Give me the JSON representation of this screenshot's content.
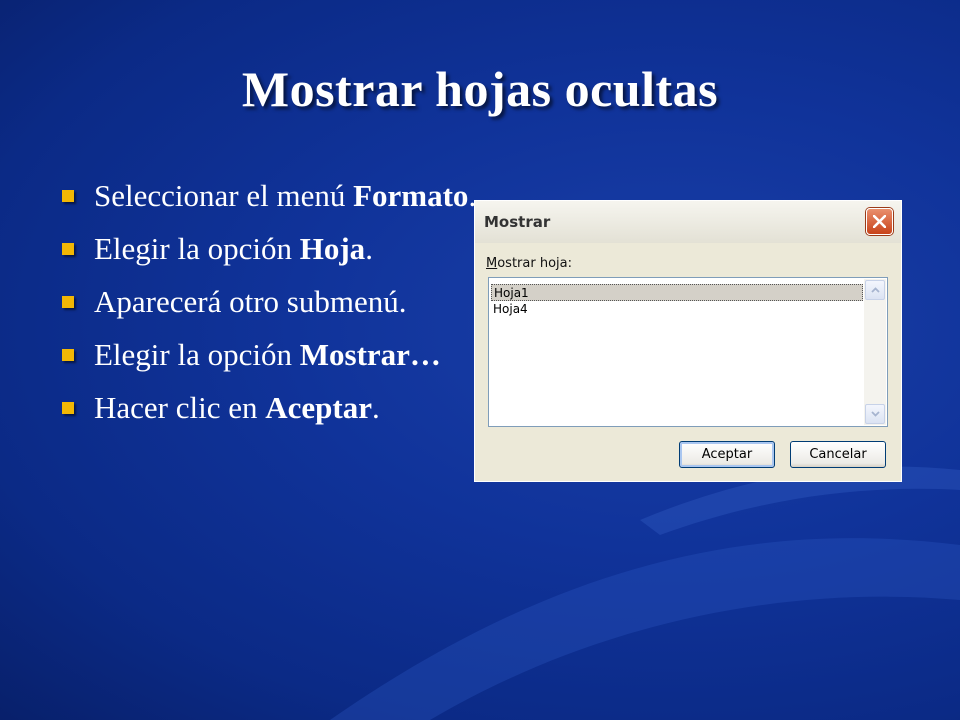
{
  "slide": {
    "title": "Mostrar hojas ocultas",
    "bullets": [
      {
        "text": "Seleccionar el menú ",
        "bold": "Formato",
        "tail": "."
      },
      {
        "text": "Elegir la opción ",
        "bold": "Hoja",
        "tail": "."
      },
      {
        "text": "Aparecerá otro submenú.",
        "bold": "",
        "tail": ""
      },
      {
        "text": "Elegir la opción ",
        "bold": "Mostrar…",
        "tail": ""
      },
      {
        "text": "Hacer clic en ",
        "bold": "Aceptar",
        "tail": "."
      }
    ],
    "colors": {
      "background": "#10339a",
      "bullet": "#f2b705",
      "text": "#ffffff"
    }
  },
  "dialog": {
    "title": "Mostrar",
    "label_mnemonic": "M",
    "label_rest": "ostrar hoja:",
    "items": [
      "Hoja1",
      "Hoja4"
    ],
    "selected_index": 0,
    "ok_label": "Aceptar",
    "cancel_label": "Cancelar",
    "close_icon": "close-icon",
    "scroll_up_icon": "chevron-up-icon",
    "scroll_down_icon": "chevron-down-icon"
  }
}
